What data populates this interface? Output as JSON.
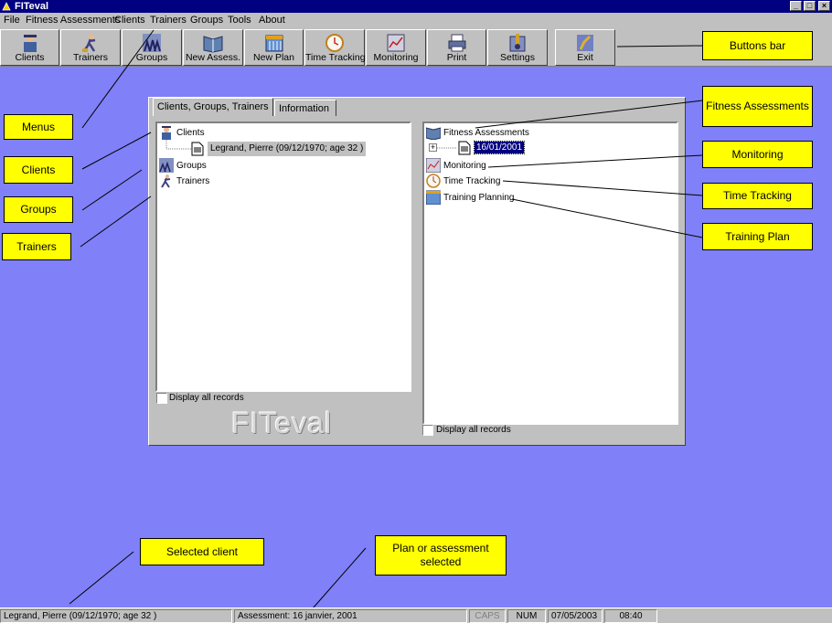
{
  "window": {
    "title": "FITeval"
  },
  "menu": {
    "items": [
      {
        "key": "file",
        "label": "File"
      },
      {
        "key": "fitness",
        "label": "Fitness Assessments"
      },
      {
        "key": "clients",
        "label": "Clients"
      },
      {
        "key": "trainers",
        "label": "Trainers"
      },
      {
        "key": "groups",
        "label": "Groups"
      },
      {
        "key": "tools",
        "label": "Tools"
      },
      {
        "key": "about",
        "label": "About"
      }
    ]
  },
  "toolbar": {
    "buttons": [
      {
        "key": "clients",
        "label": "Clients",
        "icon": "client-icon"
      },
      {
        "key": "trainers",
        "label": "Trainers",
        "icon": "trainer-icon"
      },
      {
        "key": "groups",
        "label": "Groups",
        "icon": "groups-icon"
      },
      {
        "key": "new_assess",
        "label": "New Assess.",
        "icon": "book-icon"
      },
      {
        "key": "new_plan",
        "label": "New Plan",
        "icon": "calendar-icon"
      },
      {
        "key": "time_tracking",
        "label": "Time Tracking",
        "icon": "clock-icon"
      },
      {
        "key": "monitoring",
        "label": "Monitoring",
        "icon": "monitor-icon"
      },
      {
        "key": "print",
        "label": "Print",
        "icon": "printer-icon"
      },
      {
        "key": "settings",
        "label": "Settings",
        "icon": "settings-icon"
      },
      {
        "key": "exit",
        "label": "Exit",
        "icon": "exit-icon"
      }
    ]
  },
  "tabs": [
    {
      "label": "Clients, Groups, Trainers",
      "active": true
    },
    {
      "label": "Information",
      "active": false
    }
  ],
  "left_tree": {
    "root_clients": "Clients",
    "selected_client": "Legrand, Pierre (09/12/1970; age 32 )",
    "groups": "Groups",
    "trainers": "Trainers",
    "display_all": "Display all records"
  },
  "right_tree": {
    "fitness": "Fitness Assessments",
    "date": "16/01/2001",
    "monitoring": "Monitoring",
    "time_tracking": "Time Tracking",
    "training_planning": "Training Planning",
    "display_all": "Display all records"
  },
  "logo_text": "FITeval",
  "callouts": {
    "buttons_bar": "Buttons bar",
    "menus": "Menus",
    "clients": "Clients",
    "groups": "Groups",
    "trainers": "Trainers",
    "fitness": "Fitness Assessments",
    "monitoring": "Monitoring",
    "time_tracking": "Time Tracking",
    "training_plan": "Training Plan",
    "selected_client": "Selected client",
    "plan_selected": "Plan or assessment selected"
  },
  "status": {
    "client": "Legrand, Pierre (09/12/1970; age 32 )",
    "assessment": "Assessment: 16 janvier, 2001",
    "caps": "CAPS",
    "num": "NUM",
    "date": "07/05/2003",
    "time": "08:40"
  },
  "colors": {
    "desktop": "#8080f8",
    "callout": "#ffff00",
    "titlebar": "#000080",
    "face": "#c0c0c0"
  }
}
